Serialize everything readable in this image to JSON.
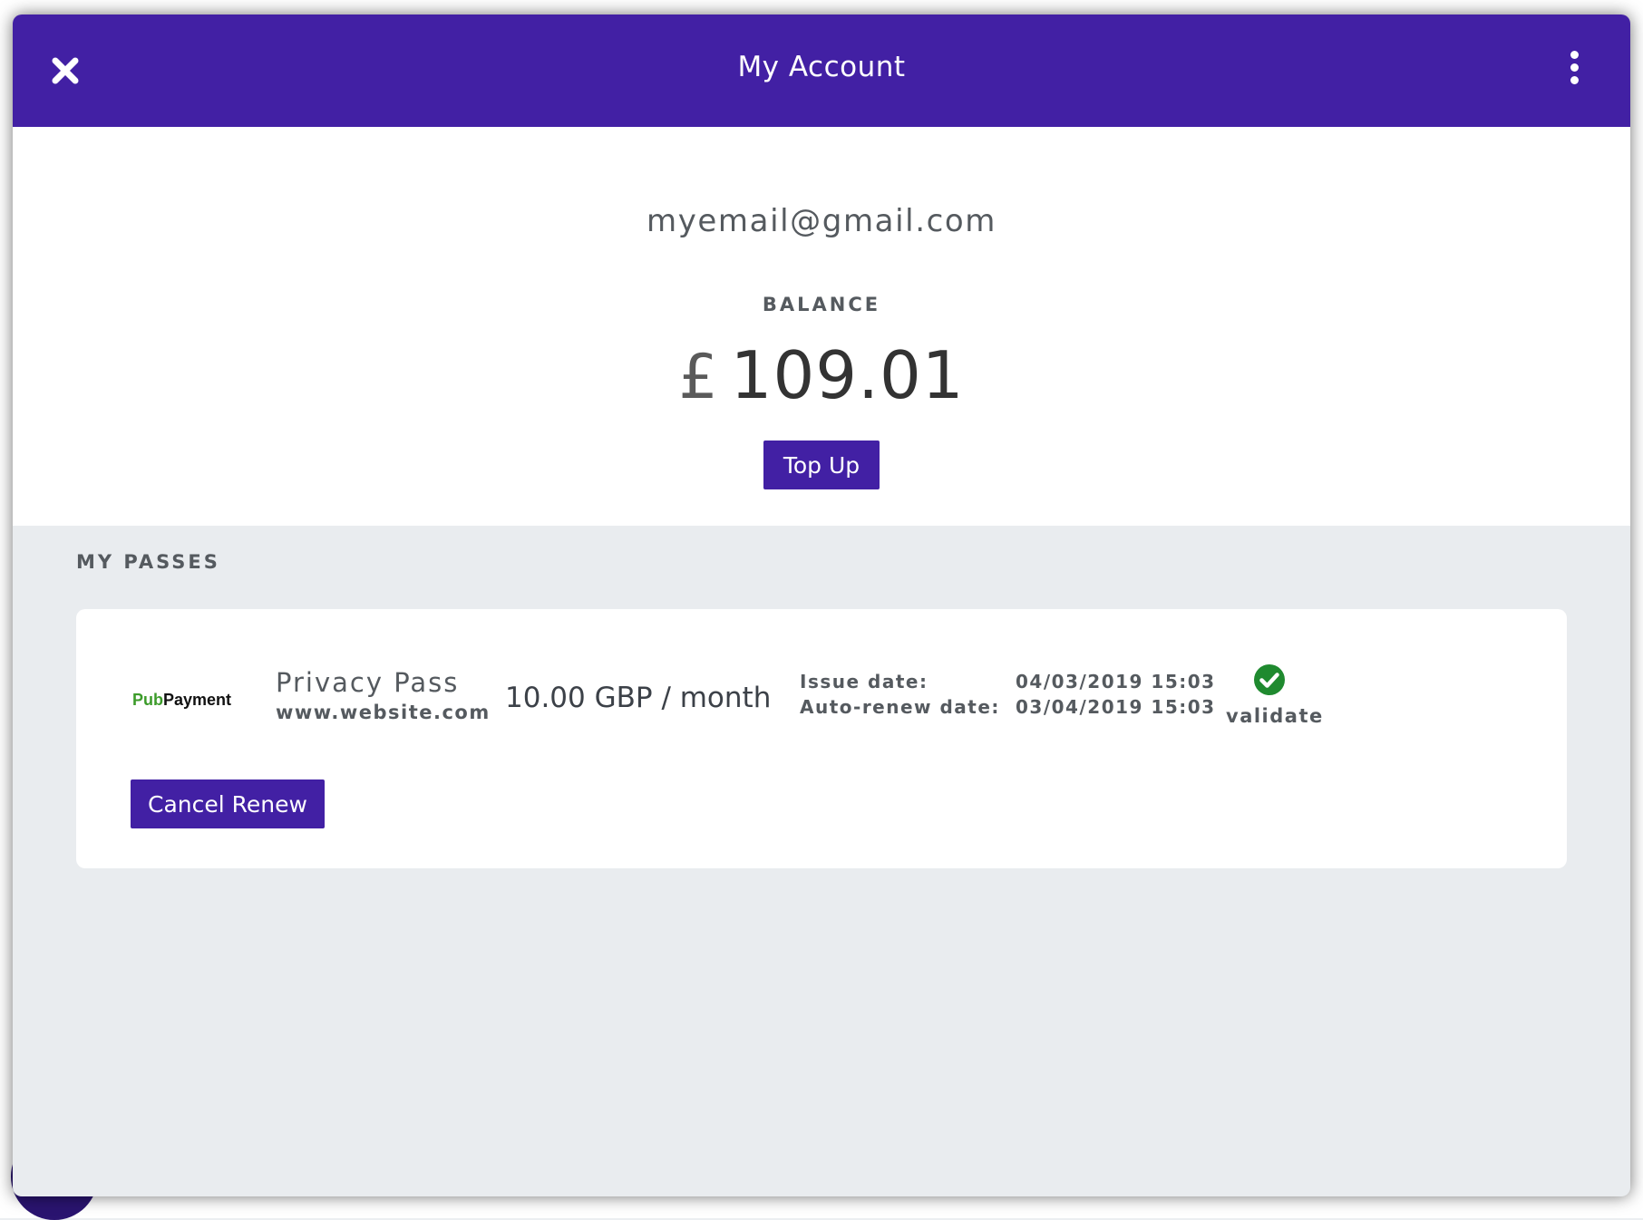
{
  "header": {
    "title": "My Account",
    "close_icon": "close-icon",
    "menu_icon": "more-vertical-icon"
  },
  "account": {
    "email": "myemail@gmail.com",
    "balance_label": "BALANCE",
    "currency_symbol": "£",
    "balance_amount": "109.01",
    "topup_label": "Top Up"
  },
  "passes": {
    "section_title": "MY PASSES",
    "items": [
      {
        "logo_pub": "Pub",
        "logo_payment": "Payment",
        "name": "Privacy Pass",
        "website": "www.website.com",
        "price": "10.00 GBP / month",
        "issue_label": "Issue date:",
        "issue_date": "04/03/2019 15:03",
        "renew_label": "Auto-renew date:",
        "renew_date": "03/04/2019 15:03",
        "status_icon": "check-circle-icon",
        "status_label": "validate",
        "cancel_label": "Cancel Renew"
      }
    ]
  },
  "colors": {
    "brand": "#4220a4",
    "success": "#1f8a2f",
    "logo_green": "#3c9b2a"
  }
}
